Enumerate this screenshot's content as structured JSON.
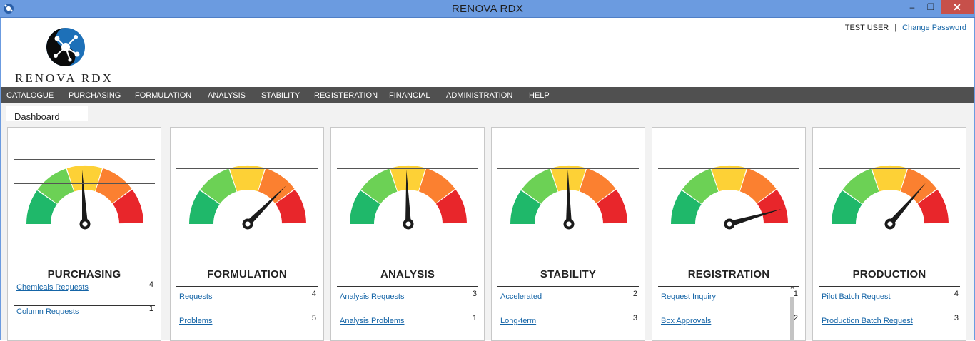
{
  "window": {
    "title": "RENOVA RDX",
    "minimize": "–",
    "maximize": "❐",
    "close": "✕"
  },
  "header": {
    "user": "TEST USER",
    "separator": "|",
    "change_password": "Change Password",
    "logo_text": "RENOVA RDX"
  },
  "menu": [
    "CATALOGUE",
    "PURCHASING",
    "FORMULATION",
    "ANALYSIS",
    "STABILITY",
    "REGISTERATION",
    "FINANCIAL",
    "ADMINISTRATION",
    "HELP"
  ],
  "tabs": [
    {
      "label": "Dashboard",
      "active": true
    }
  ],
  "gauge_colors": [
    "#1fb86a",
    "#6cd155",
    "#fdd136",
    "#fb8030",
    "#e8262b"
  ],
  "cards": [
    {
      "title": "PURCHASING",
      "needle_angle": 93,
      "rows": [
        {
          "label": "Chemicals Requests",
          "count": "4"
        },
        {
          "label": "Column Requests",
          "count": "1"
        }
      ]
    },
    {
      "title": "FORMULATION",
      "needle_angle": 45,
      "rows": [
        {
          "label": "Requests",
          "count": "4"
        },
        {
          "label": "Problems",
          "count": "5"
        }
      ]
    },
    {
      "title": "ANALYSIS",
      "needle_angle": 92,
      "rows": [
        {
          "label": "Analysis Requests",
          "count": "3"
        },
        {
          "label": "Analysis Problems",
          "count": "1"
        }
      ]
    },
    {
      "title": "STABILITY",
      "needle_angle": 91,
      "rows": [
        {
          "label": "Accelerated",
          "count": "2"
        },
        {
          "label": "Long-term",
          "count": "3"
        }
      ]
    },
    {
      "title": "REGISTRATION",
      "needle_angle": 16,
      "rows": [
        {
          "label": "Request Inquiry",
          "count": "1"
        },
        {
          "label": "Box Approvals",
          "count": "2"
        }
      ]
    },
    {
      "title": "PRODUCTION",
      "needle_angle": 49,
      "rows": [
        {
          "label": "Pilot Batch Request",
          "count": "4"
        },
        {
          "label": "Production Batch Request",
          "count": "3"
        }
      ]
    }
  ],
  "scroll_up_icon": "chevron-up-icon"
}
